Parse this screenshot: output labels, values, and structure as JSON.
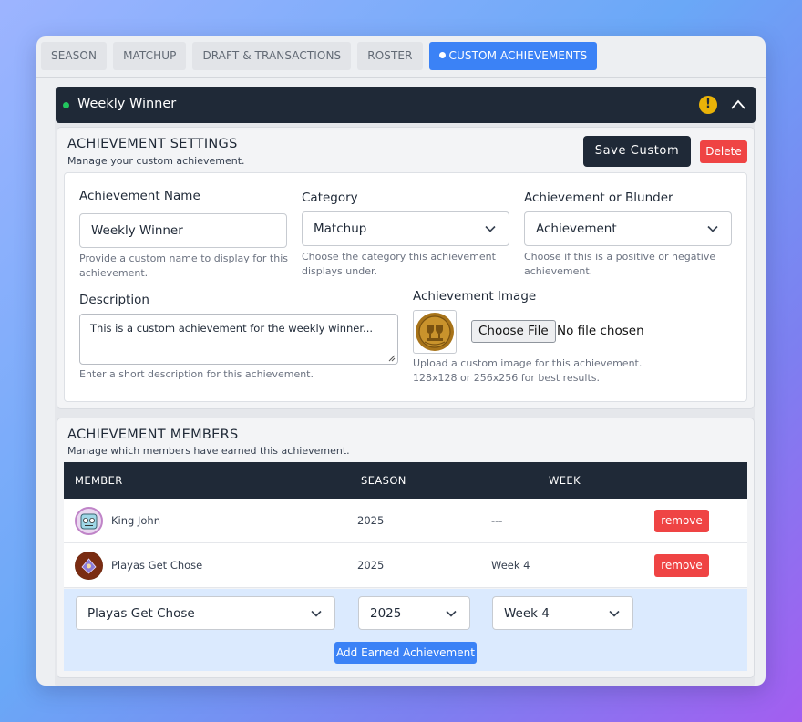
{
  "tabs": [
    {
      "label": "SEASON"
    },
    {
      "label": "MATCHUP"
    },
    {
      "label": "DRAFT & TRANSACTIONS"
    },
    {
      "label": "ROSTER"
    },
    {
      "label": "CUSTOM ACHIEVEMENTS"
    }
  ],
  "header": {
    "title": "Weekly Winner",
    "warning_glyph": "!"
  },
  "settings": {
    "title": "ACHIEVEMENT SETTINGS",
    "subtitle": "Manage your custom achievement.",
    "save_label": "Save Custom",
    "delete_label": "Delete",
    "name": {
      "label": "Achievement Name",
      "value": "Weekly Winner",
      "help": "Provide a custom name to display for this achievement."
    },
    "category": {
      "label": "Category",
      "value": "Matchup",
      "help": "Choose the category this achievement displays under."
    },
    "kind": {
      "label": "Achievement or Blunder",
      "value": "Achievement",
      "help": "Choose if this is a positive or negative achievement."
    },
    "description": {
      "label": "Description",
      "value": "This is a custom achievement for the weekly winner...",
      "help": "Enter a short description for this achievement."
    },
    "image": {
      "label": "Achievement Image",
      "choose_label": "Choose File",
      "file_status": "No file chosen",
      "help_line1": "Upload a custom image for this achievement.",
      "help_line2": "128x128 or 256x256 for best results."
    }
  },
  "members": {
    "title": "ACHIEVEMENT MEMBERS",
    "subtitle": "Manage which members have earned this achievement.",
    "columns": [
      "MEMBER",
      "SEASON",
      "WEEK"
    ],
    "rows": [
      {
        "member": "King John",
        "season": "2025",
        "week": "---",
        "action": "remove"
      },
      {
        "member": "Playas Get Chose",
        "season": "2025",
        "week": "Week 4",
        "action": "remove"
      }
    ],
    "new_entry": {
      "member": "Playas Get Chose",
      "season": "2025",
      "week": "Week 4",
      "add_label": "Add Earned Achievement"
    }
  },
  "colors": {
    "accent": "#3b82f6",
    "dark": "#1f2937",
    "danger": "#ef4444",
    "success": "#22c55e",
    "warning": "#eab308"
  },
  "icons": [
    "warning-icon",
    "chevron-up-icon",
    "chevron-down-icon",
    "trophy-icon",
    "avatar-icon"
  ]
}
